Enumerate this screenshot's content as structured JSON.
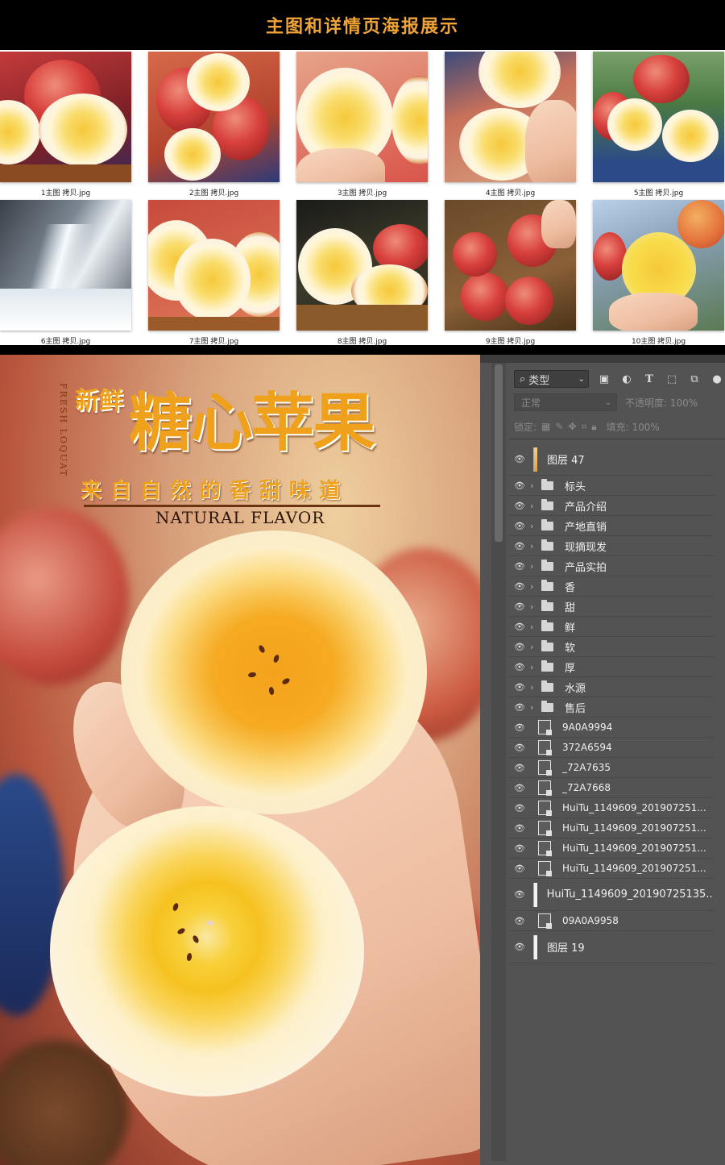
{
  "header": {
    "title": "主图和详情页海报展示"
  },
  "thumbnails": [
    {
      "caption": "1主图 拷贝.jpg"
    },
    {
      "caption": "2主图 拷贝.jpg"
    },
    {
      "caption": "3主图 拷贝.jpg"
    },
    {
      "caption": "4主图 拷贝.jpg"
    },
    {
      "caption": "5主图 拷贝.jpg"
    },
    {
      "caption": "6主图 拷贝.jpg"
    },
    {
      "caption": "7主图 拷贝.jpg"
    },
    {
      "caption": "8主图 拷贝.jpg"
    },
    {
      "caption": "9主图 拷贝.jpg"
    },
    {
      "caption": "10主图 拷贝.jpg"
    }
  ],
  "poster": {
    "fresh": "新鲜",
    "title": "糖心苹果",
    "vertical_text": "FRESH LOQUAT",
    "subtitle": "来自自然的香甜味道",
    "english": "NATURAL FLAVOR"
  },
  "layers_panel": {
    "filter_label": "类型",
    "blend_mode": "正常",
    "opacity_label": "不透明度: 100%",
    "lock_label": "锁定:",
    "fill_label": "填充: 100%",
    "layers": [
      {
        "name": "图层 47",
        "kind": "pixel-orange"
      },
      {
        "name": "标头",
        "kind": "group"
      },
      {
        "name": "产品介绍",
        "kind": "group"
      },
      {
        "name": "产地直销",
        "kind": "group"
      },
      {
        "name": "现摘现发",
        "kind": "group"
      },
      {
        "name": "产品实拍",
        "kind": "group"
      },
      {
        "name": "香",
        "kind": "group"
      },
      {
        "name": "甜",
        "kind": "group"
      },
      {
        "name": "鲜",
        "kind": "group"
      },
      {
        "name": "软",
        "kind": "group"
      },
      {
        "name": "厚",
        "kind": "group"
      },
      {
        "name": "水源",
        "kind": "group"
      },
      {
        "name": "售后",
        "kind": "group"
      },
      {
        "name": "9A0A9994",
        "kind": "smart"
      },
      {
        "name": "372A6594",
        "kind": "smart"
      },
      {
        "name": "_72A7635",
        "kind": "smart"
      },
      {
        "name": "_72A7668",
        "kind": "smart"
      },
      {
        "name": "HuiTu_1149609_201907251...",
        "kind": "smart"
      },
      {
        "name": "HuiTu_1149609_201907251...",
        "kind": "smart"
      },
      {
        "name": "HuiTu_1149609_201907251...",
        "kind": "smart"
      },
      {
        "name": "HuiTu_1149609_201907251...",
        "kind": "smart"
      },
      {
        "name": "HuiTu_1149609_20190725135...",
        "kind": "pixel"
      },
      {
        "name": "09A0A9958",
        "kind": "smart"
      },
      {
        "name": "图层 19",
        "kind": "pixel"
      }
    ]
  },
  "colors": {
    "accent": "#f0a437",
    "panel_bg": "#535353"
  }
}
